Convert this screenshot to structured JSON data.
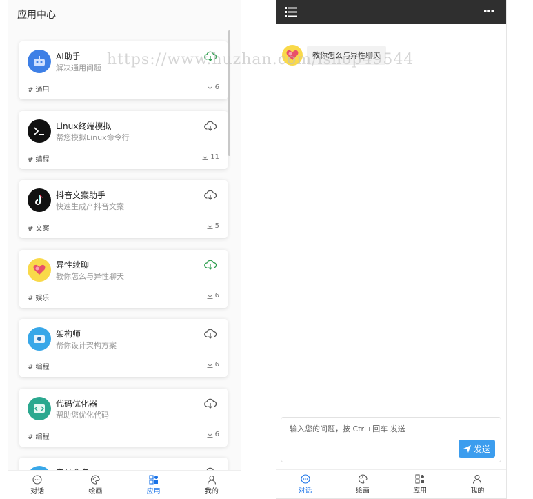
{
  "left": {
    "header_title": "应用中心",
    "apps": [
      {
        "title": "AI助手",
        "desc": "解决通用问题",
        "tag": "# 通用",
        "count": "6",
        "dl_color": "#2e9e4f",
        "avatar_color": "#3d7fe6",
        "icon": "robot-icon"
      },
      {
        "title": "Linux终端模拟",
        "desc": "帮您模拟Linux命令行",
        "tag": "# 编程",
        "count": "11",
        "dl_color": "#555555",
        "avatar_color": "#111111",
        "icon": "terminal-icon"
      },
      {
        "title": "抖音文案助手",
        "desc": "快速生成产抖音文案",
        "tag": "# 文案",
        "count": "5",
        "dl_color": "#555555",
        "avatar_color": "#111111",
        "icon": "tiktok-icon"
      },
      {
        "title": "异性续聊",
        "desc": "教你怎么与异性聊天",
        "tag": "# 娱乐",
        "count": "6",
        "dl_color": "#2e9e4f",
        "avatar_color": "#f9d94a",
        "icon": "heart-icon"
      },
      {
        "title": "架构师",
        "desc": "帮你设计架构方案",
        "tag": "# 编程",
        "count": "6",
        "dl_color": "#555555",
        "avatar_color": "#38a7e8",
        "icon": "architect-icon"
      },
      {
        "title": "代码优化器",
        "desc": "帮助您优化代码",
        "tag": "# 编程",
        "count": "6",
        "dl_color": "#555555",
        "avatar_color": "#2ba88f",
        "icon": "code-icon"
      },
      {
        "title": "产品命名",
        "desc": "",
        "tag": "",
        "count": "",
        "dl_color": "#555555",
        "avatar_color": "#38a7e8",
        "icon": "product-icon"
      }
    ]
  },
  "tabs": [
    {
      "label": "对话",
      "icon": "chat-icon"
    },
    {
      "label": "绘画",
      "icon": "palette-icon"
    },
    {
      "label": "应用",
      "icon": "apps-icon"
    },
    {
      "label": "我的",
      "icon": "user-icon"
    }
  ],
  "left_active_tab": 2,
  "right_active_tab": 0,
  "right": {
    "message": "教你怎么与异性聊天",
    "input_placeholder": "输入您的问题，按 Ctrl+回车 发送",
    "send_label": "发送"
  },
  "watermark": "https://www.huzhan.com/ishop49544",
  "colors": {
    "accent": "#1a73e8",
    "send_button": "#3c9dee",
    "topbar": "#2f2f2f"
  }
}
